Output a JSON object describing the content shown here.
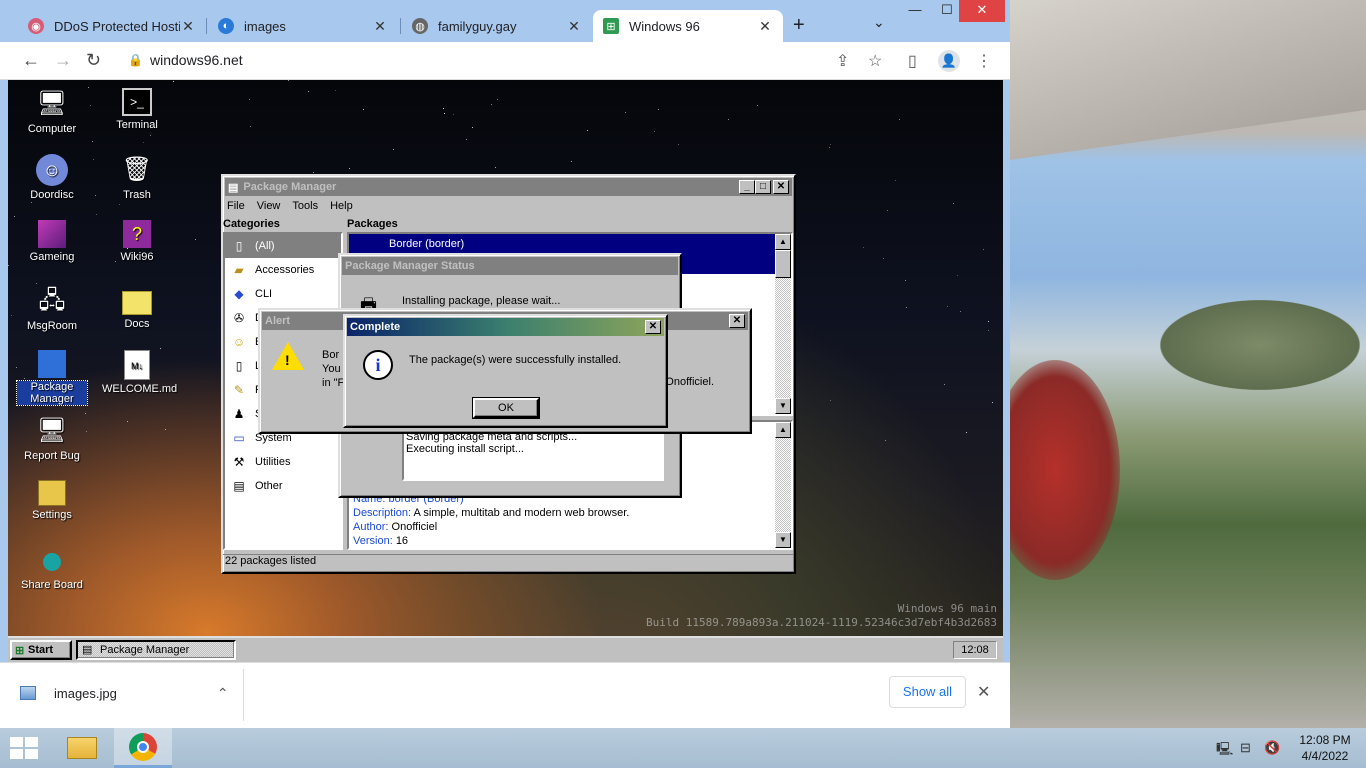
{
  "browser": {
    "tabs": [
      {
        "title": "DDoS Protected Hosting",
        "icon": "hosting-favicon",
        "active": false
      },
      {
        "title": "images",
        "icon": "images-favicon",
        "active": false
      },
      {
        "title": "familyguy.gay",
        "icon": "globe-favicon",
        "active": false
      },
      {
        "title": "Windows 96",
        "icon": "windows96-favicon",
        "active": true
      }
    ],
    "url": "windows96.net",
    "download": {
      "filename": "images.jpg",
      "show_all": "Show all"
    }
  },
  "desktop": {
    "icons": [
      {
        "label": "Computer",
        "icon": "computer-icon"
      },
      {
        "label": "Terminal",
        "icon": "terminal-icon"
      },
      {
        "label": "Doordisc",
        "icon": "discord-icon"
      },
      {
        "label": "Trash",
        "icon": "trash-icon"
      },
      {
        "label": "Gameing",
        "icon": "game-cube-icon"
      },
      {
        "label": "Wiki96",
        "icon": "wiki-book-icon"
      },
      {
        "label": "MsgRoom",
        "icon": "msgroom-icon"
      },
      {
        "label": "Docs",
        "icon": "folder-icon"
      },
      {
        "label": "Package Manager",
        "icon": "package-icon"
      },
      {
        "label": "WELCOME.md",
        "icon": "markdown-file-icon"
      },
      {
        "label": "Report Bug",
        "icon": "report-bug-icon"
      },
      {
        "label": "Settings",
        "icon": "settings-icon"
      },
      {
        "label": "Share Board",
        "icon": "share-board-icon"
      }
    ],
    "watermark": {
      "line1": "Windows 96 main",
      "line2": "Build 11589.789a893a.211024-1119.52346c3d7ebf4b3d2683"
    }
  },
  "package_manager": {
    "title": "Package Manager",
    "menu": [
      "File",
      "View",
      "Tools",
      "Help"
    ],
    "categories_header": "Categories",
    "packages_header": "Packages",
    "categories": [
      {
        "label": "(All)",
        "icon": "all-icon"
      },
      {
        "label": "Accessories",
        "icon": "accessories-icon"
      },
      {
        "label": "CLI",
        "icon": "cli-icon"
      },
      {
        "label": "D",
        "icon": "dev-icon"
      },
      {
        "label": "E",
        "icon": "entertainment-icon"
      },
      {
        "label": "L",
        "icon": "lib-icon"
      },
      {
        "label": "P",
        "icon": "productivity-icon"
      },
      {
        "label": "S",
        "icon": "social-icon"
      },
      {
        "label": "System",
        "icon": "system-icon"
      },
      {
        "label": "Utilities",
        "icon": "utilities-icon"
      },
      {
        "label": "Other",
        "icon": "other-icon"
      }
    ],
    "selected_package": "Border (border)",
    "details": {
      "name_label": "Name:",
      "name_value": "border (Border)",
      "desc_label": "Description:",
      "desc_value": "A simple, multitab and modern web browser.",
      "author_label": "Author:",
      "author_value": "Onofficiel",
      "version_label": "Version:",
      "version_value": "16"
    },
    "status_count": "22 packages listed"
  },
  "status_window": {
    "title": "Package Manager Status",
    "message": "Installing package, please wait...",
    "log": [
      "Saving package meta and scripts...",
      "Executing install script..."
    ]
  },
  "alert": {
    "title": "Alert",
    "text_a": "Bor",
    "text_b": "You",
    "text_c": "in \"F",
    "text_tail": "g ! Onofficiel."
  },
  "complete": {
    "title": "Complete",
    "message": "The package(s) were successfully installed.",
    "ok": "OK"
  },
  "taskbar96": {
    "start": "Start",
    "task": "Package Manager",
    "clock": "12:08"
  },
  "windows": {
    "time": "12:08 PM",
    "date": "4/4/2022"
  },
  "colors": {
    "selection": "#000080",
    "win_title_active": "#0a246a",
    "close_red": "#e04343"
  }
}
